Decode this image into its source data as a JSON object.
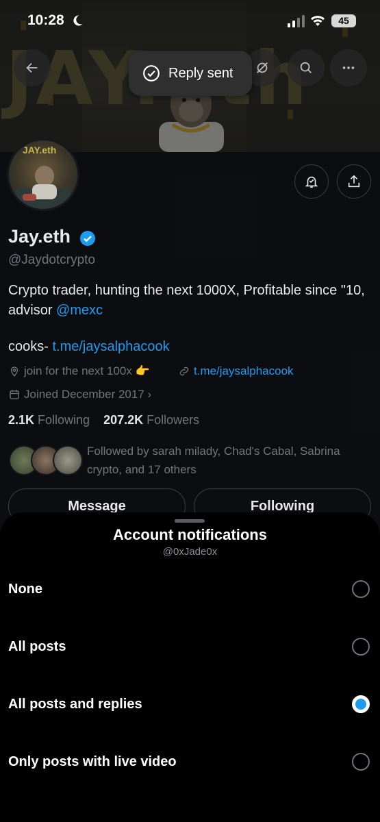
{
  "status_bar": {
    "time": "10:28",
    "battery": "45"
  },
  "banner": {
    "title": "JAY.eth"
  },
  "toast": {
    "text": "Reply sent"
  },
  "profile": {
    "avatar_tag": "JAY.eth",
    "name": "Jay.eth",
    "handle": "@Jaydotcrypto",
    "bio_text": "Crypto trader, hunting the next 1000X, Profitable since \"10, advisor ",
    "bio_mention": "@mexc",
    "cooks_prefix": "cooks- ",
    "cooks_link": "t.me/jaysalphacook",
    "location": "join for the next 100x 👉",
    "website": "t.me/jaysalphacook",
    "joined": "Joined December 2017 ›",
    "following_count": "2.1K",
    "following_label": " Following",
    "followers_count": "207.2K",
    "followers_label": " Followers",
    "followed_by": "Followed by sarah milady, Chad's Cabal, Sabrina crypto, and 17 others",
    "message_button": "Message",
    "following_button": "Following"
  },
  "sheet": {
    "title": "Account notifications",
    "subtitle": "@0xJade0x",
    "options": [
      {
        "label": "None",
        "selected": false
      },
      {
        "label": "All posts",
        "selected": false
      },
      {
        "label": "All posts and replies",
        "selected": true
      },
      {
        "label": "Only posts with live video",
        "selected": false
      }
    ]
  },
  "colors": {
    "accent": "#1d9bf0",
    "sheet_bg": "#000000",
    "profile_bg": "#15181c"
  }
}
